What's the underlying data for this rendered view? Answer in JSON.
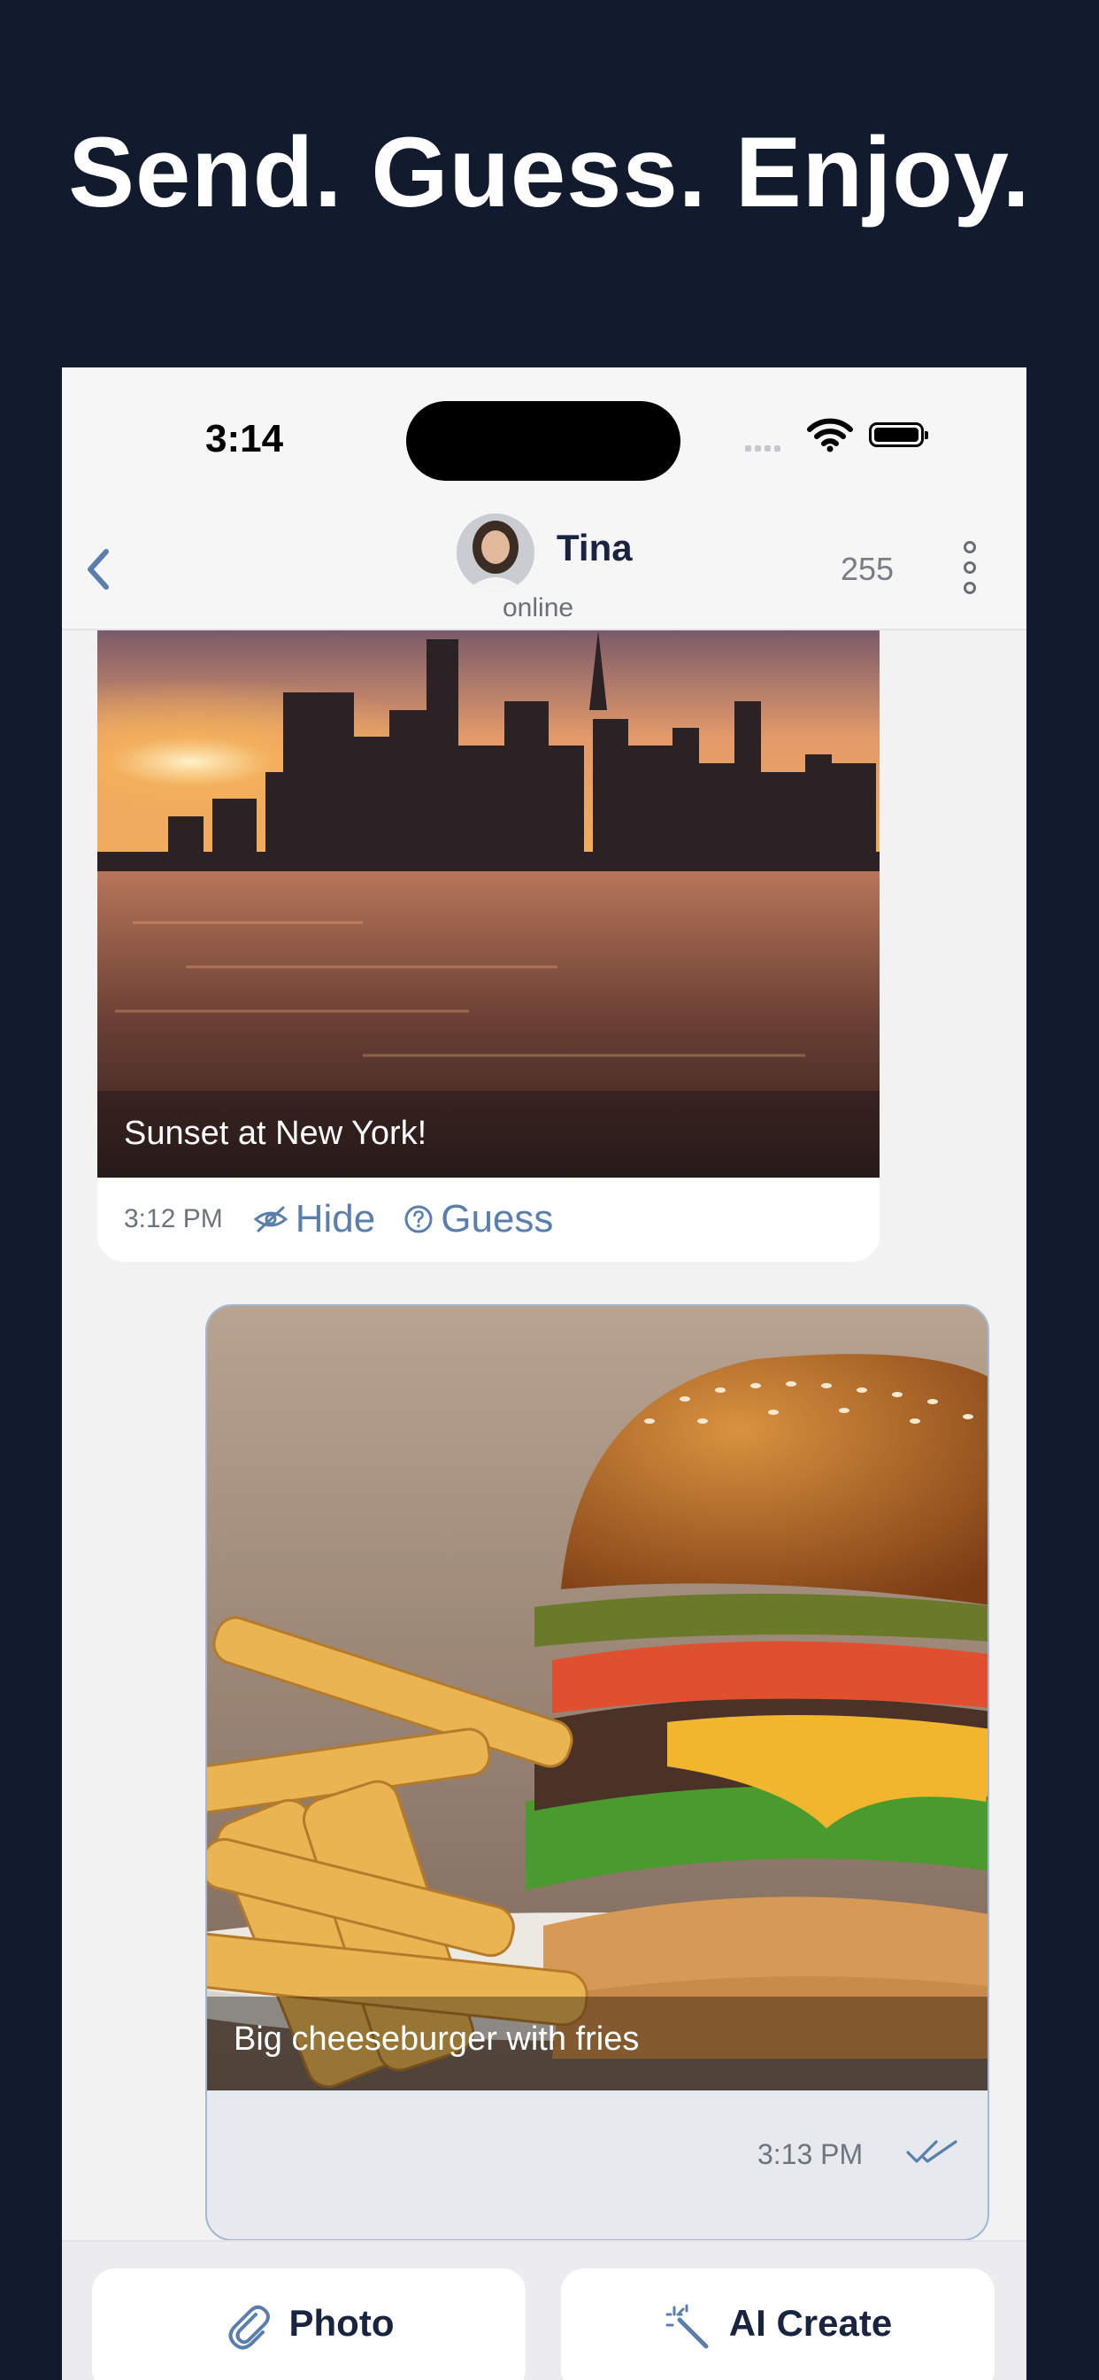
{
  "headline": "Send. Guess. Enjoy.",
  "status_bar": {
    "time": "3:14"
  },
  "chat_header": {
    "name": "Tina",
    "status": "online",
    "count": "255"
  },
  "messages": [
    {
      "caption": "Sunset at New York!",
      "time": "3:12 PM",
      "actions": {
        "hide": "Hide",
        "guess": "Guess"
      }
    },
    {
      "caption": "Big cheeseburger with fries",
      "time": "3:13 PM"
    }
  ],
  "bottom_bar": {
    "photo": "Photo",
    "ai_create": "AI Create"
  },
  "colors": {
    "background": "#121a2e",
    "accent": "#5b7fad",
    "outgoing_bubble": "#e6e9ee"
  },
  "icons": [
    "back-chevron-icon",
    "more-vertical-icon",
    "hide-eye-icon",
    "guess-question-icon",
    "read-checks-icon",
    "paperclip-icon",
    "magic-wand-icon"
  ]
}
